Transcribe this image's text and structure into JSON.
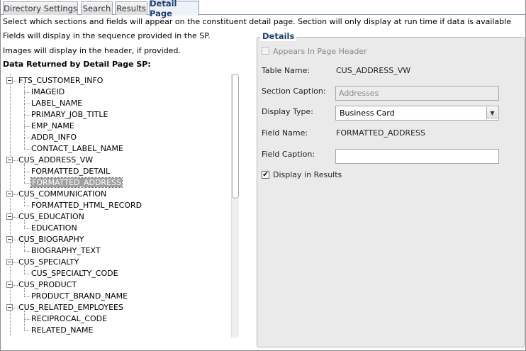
{
  "tabs": [
    {
      "label": "Directory Settings",
      "active": false
    },
    {
      "label": "Search",
      "active": false
    },
    {
      "label": "Results",
      "active": false
    },
    {
      "label": "Detail Page",
      "active": true
    }
  ],
  "info": {
    "line1": "Select which sections and fields will appear on the constituent detail page. Section will only display at run time if data is available",
    "line2": "Fields will display in the sequence provided in the SP.",
    "line3": "Images will display in the header, if provided.",
    "tree_heading": "Data Returned by Detail Page SP:"
  },
  "tree": {
    "groups": [
      {
        "label": "FTS_CUSTOMER_INFO",
        "children": [
          "IMAGEID",
          "LABEL_NAME",
          "PRIMARY_JOB_TITLE",
          "EMP_NAME",
          "ADDR_INFO",
          "CONTACT_LABEL_NAME"
        ]
      },
      {
        "label": "CUS_ADDRESS_VW",
        "children": [
          "FORMATTED_DETAIL",
          "FORMATTED_ADDRESS"
        ]
      },
      {
        "label": "CUS_COMMUNICATION",
        "children": [
          "FORMATTED_HTML_RECORD"
        ]
      },
      {
        "label": "CUS_EDUCATION",
        "children": [
          "EDUCATION"
        ]
      },
      {
        "label": "CUS_BIOGRAPHY",
        "children": [
          "BIOGRAPHY_TEXT"
        ]
      },
      {
        "label": "CUS_SPECIALTY",
        "children": [
          "CUS_SPECIALTY_CODE"
        ]
      },
      {
        "label": "CUS_PRODUCT",
        "children": [
          "PRODUCT_BRAND_NAME"
        ]
      },
      {
        "label": "CUS_RELATED_EMPLOYEES",
        "children": [
          "RECIPROCAL_CODE",
          "RELATED_NAME"
        ]
      }
    ],
    "selected": "FORMATTED_ADDRESS"
  },
  "details": {
    "legend": "Details",
    "appears_in_header_label": "Appears In Page Header",
    "table_name_label": "Table Name:",
    "table_name_value": "CUS_ADDRESS_VW",
    "section_caption_label": "Section Caption:",
    "section_caption_placeholder": "Addresses",
    "display_type_label": "Display Type:",
    "display_type_value": "Business Card",
    "field_name_label": "Field Name:",
    "field_name_value": "FORMATTED_ADDRESS",
    "field_caption_label": "Field Caption:",
    "field_caption_value": "",
    "display_in_results_label": "Display in Results",
    "display_in_results_checked": true
  },
  "colors": {
    "accent": "#1a3f7a",
    "panel_bg": "#eaeaea",
    "selection_bg": "#a0a0a0"
  }
}
